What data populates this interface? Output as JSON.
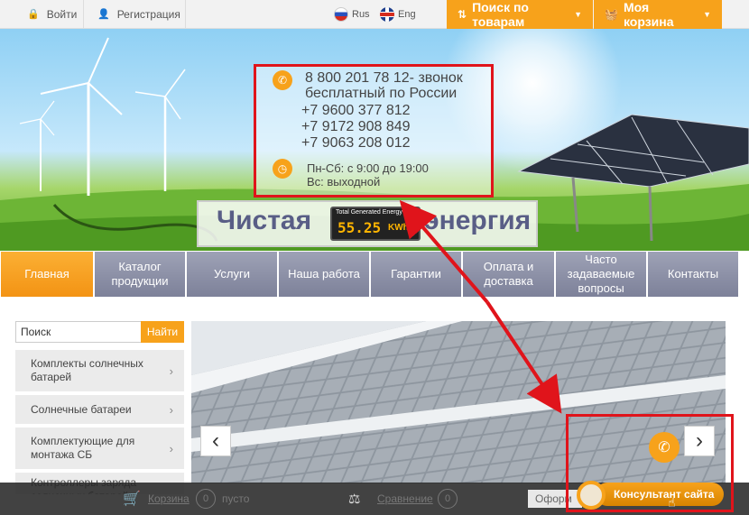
{
  "topbar": {
    "login_label": "Войти",
    "register_label": "Регистрация",
    "lang_ru": "Rus",
    "lang_en": "Eng",
    "search_products_label": "Поиск по товарам",
    "cart_label": "Моя корзина"
  },
  "banner": {
    "phone_line1": "8 800 201 78 12- звонок",
    "phone_line2": "бесплатный по России",
    "phones": [
      "+7 9600 377 812",
      "+7 9172 908 849",
      "+7 9063 208 012"
    ],
    "hours_line1": "Пн-Сб: с 9:00 до 19:00",
    "hours_line2": "Вс: выходной",
    "logo_word1": "Чистая",
    "logo_word2": "энергия",
    "counter_title": "Total Generated Energy",
    "counter_value": "55.25",
    "counter_unit": "KWh"
  },
  "nav": {
    "items": [
      {
        "label": "Главная"
      },
      {
        "label": "Каталог продукции"
      },
      {
        "label": "Услуги"
      },
      {
        "label": "Наша работа"
      },
      {
        "label": "Гарантии"
      },
      {
        "label": "Оплата и доставка"
      },
      {
        "label": "Часто задаваемые вопросы"
      },
      {
        "label": "Контакты"
      }
    ]
  },
  "sidebar": {
    "search_placeholder": "Поиск",
    "search_button": "Найти",
    "items": [
      {
        "label": "Комплекты солнечных батарей"
      },
      {
        "label": "Солнечные батареи"
      },
      {
        "label": "Комплектующие для монтажа СБ"
      },
      {
        "label": "Контроллеры заряда солнечных батарей"
      }
    ]
  },
  "bottombar": {
    "cart_label": "Корзина",
    "cart_count": "0",
    "cart_status": "пусто",
    "compare_label": "Сравнение",
    "compare_count": "0",
    "checkout_label": "Оформ",
    "consultant_label": "Консультант сайта"
  },
  "colors": {
    "accent": "#f7a21b",
    "nav_gray": "#8c90a8",
    "highlight_red": "#e0141b"
  }
}
